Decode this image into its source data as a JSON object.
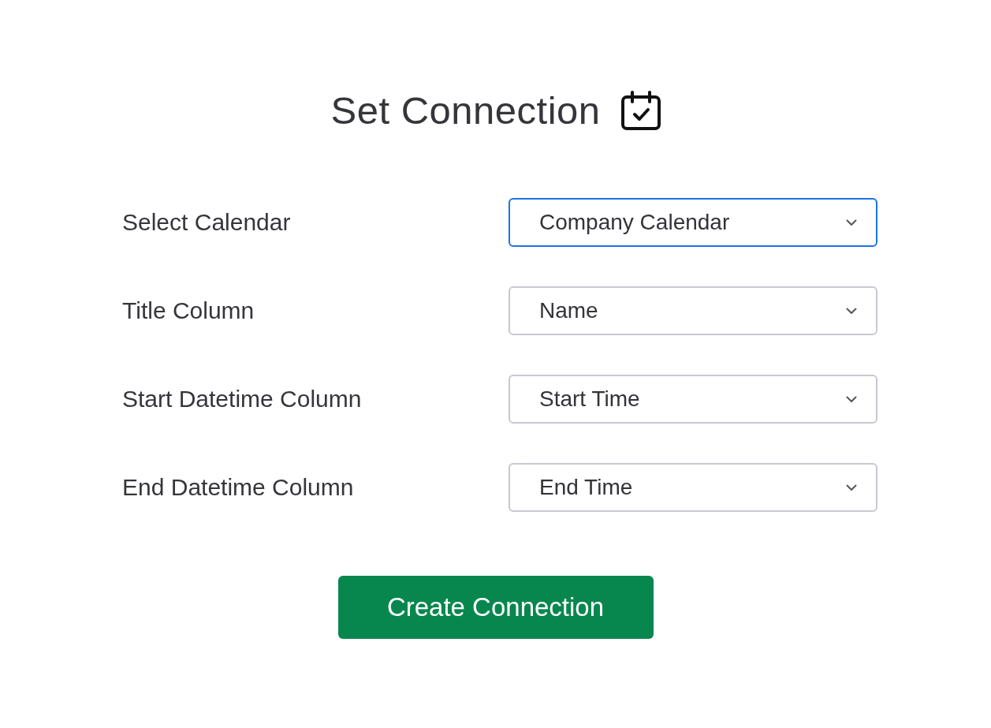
{
  "title": {
    "text": "Set Connection"
  },
  "fields": [
    {
      "label": "Select Calendar",
      "value": "Company Calendar",
      "focused": true
    },
    {
      "label": "Title Column",
      "value": "Name",
      "focused": false
    },
    {
      "label": "Start Datetime Column",
      "value": "Start Time",
      "focused": false
    },
    {
      "label": "End Datetime Column",
      "value": "End Time",
      "focused": false
    }
  ],
  "button": {
    "label": "Create Connection"
  }
}
